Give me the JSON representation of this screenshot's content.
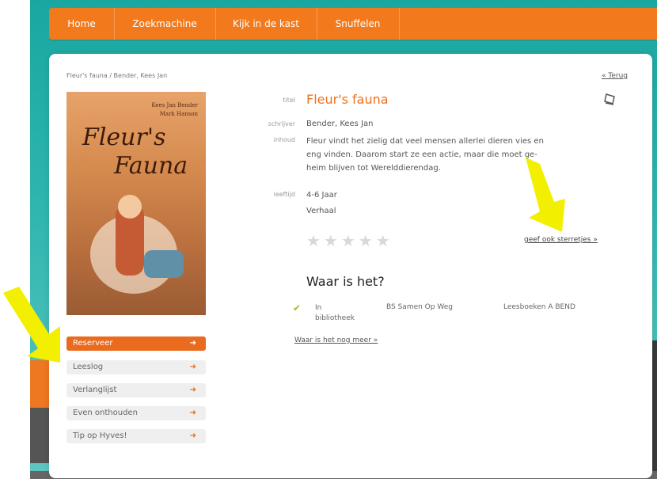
{
  "nav": {
    "home": "Home",
    "zoekmachine": "Zoekmachine",
    "kast": "Kijk in de kast",
    "snuffelen": "Snuffelen"
  },
  "breadcrumb": "Fleur's fauna / Bender, Kees Jan",
  "back_link": "« Terug",
  "cover": {
    "authors": [
      "Kees Jan Bender",
      "Mark Hanson"
    ],
    "title_line1": "Fleur's",
    "title_line2": "Fauna"
  },
  "actions": [
    {
      "label": "Reserveer",
      "icon": "arrow-right-icon",
      "primary": true
    },
    {
      "label": "Leeslog",
      "icon": "arrow-right-icon",
      "primary": false
    },
    {
      "label": "Verlanglijst",
      "icon": "arrow-right-icon",
      "primary": false
    },
    {
      "label": "Even onthouden",
      "icon": "arrow-right-icon",
      "primary": false
    },
    {
      "label": "Tip op Hyves!",
      "icon": "arrow-right-icon",
      "primary": false
    }
  ],
  "details": {
    "titel_label": "titel",
    "titel_value": "Fleur's fauna",
    "schrijver_label": "schrijver",
    "schrijver_value": "Bender, Kees Jan",
    "inhoud_label": "inhoud",
    "inhoud_lines": [
      "Fleur vindt het zielig dat veel mensen allerlei dieren vies en",
      "eng vinden. Daarom start ze een actie, maar die moet ge-",
      "heim blijven tot Werelddierendag."
    ],
    "leeftijd_label": "leeftijd",
    "leeftijd_value": "4-6 Jaar",
    "genre_value": "Verhaal"
  },
  "rating": {
    "stars": "★★★★★",
    "star_count": 5,
    "filled": 0,
    "cta": "geef ook sterretjes »"
  },
  "availability": {
    "heading": "Waar is het?",
    "status_line1": "In",
    "status_line2": "bibliotheek",
    "location": "BS Samen Op Weg",
    "collection": "Leesboeken A BEND",
    "more_link": "Waar is het nog meer »"
  },
  "colors": {
    "accent_orange": "#f27a1c",
    "title_orange": "#f07218",
    "teal_bg": "#1aa7a1",
    "annotation_yellow": "#f2f000",
    "check_green": "#9bbf2e"
  }
}
